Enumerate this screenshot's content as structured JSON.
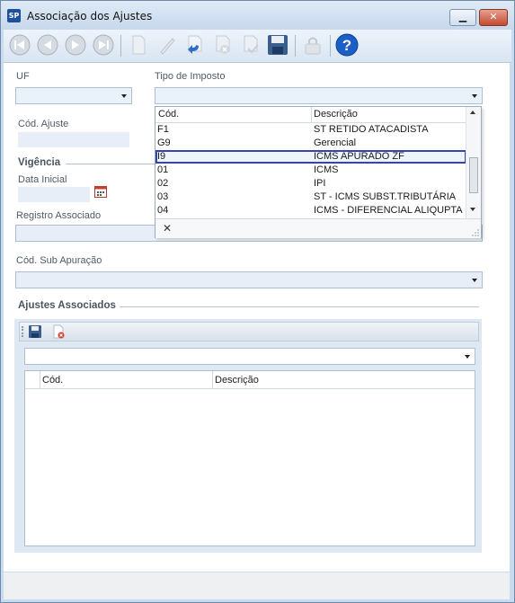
{
  "window": {
    "title": "Associação dos Ajustes",
    "icon_text": "SP",
    "minimize_icon": "minimize-icon",
    "close_icon": "close-icon"
  },
  "toolbar": {
    "buttons": [
      "first-record-icon",
      "previous-record-icon",
      "next-record-icon",
      "last-record-icon",
      "new-document-icon",
      "edit-icon",
      "undo-icon",
      "delete-icon",
      "confirm-icon",
      "save-icon",
      "lock-icon",
      "help-icon"
    ]
  },
  "form": {
    "uf_label": "UF",
    "tipo_imposto_label": "Tipo de Imposto",
    "cod_ajuste_label": "Cód. Ajuste",
    "vigencia_title": "Vigência",
    "data_inicial_label": "Data Inicial",
    "registro_associado_label": "Registro Associado",
    "cod_sub_apuracao_label": "Cód. Sub Apuração",
    "ajustes_associados_title": "Ajustes Associados"
  },
  "dropdown": {
    "columns": [
      "Cód.",
      "Descrição"
    ],
    "rows": [
      {
        "code": "F1",
        "desc": "ST RETIDO ATACADISTA"
      },
      {
        "code": "G9",
        "desc": "Gerencial"
      },
      {
        "code": "I9",
        "desc": "ICMS APURADO ZF"
      },
      {
        "code": "01",
        "desc": "ICMS"
      },
      {
        "code": "02",
        "desc": "IPI"
      },
      {
        "code": "03",
        "desc": "ST - ICMS SUBST.TRIBUTÁRIA"
      },
      {
        "code": "04",
        "desc": "ICMS - DIFERENCIAL ALIQUPTA"
      }
    ],
    "selected_code": "I9",
    "clear_symbol": "✕"
  },
  "grid": {
    "columns": [
      "Cód.",
      "Descrição"
    ]
  },
  "colors": {
    "selection_border": "#3845a6",
    "window_frame": "#c9dcef",
    "help_blue": "#1a5fc8"
  }
}
